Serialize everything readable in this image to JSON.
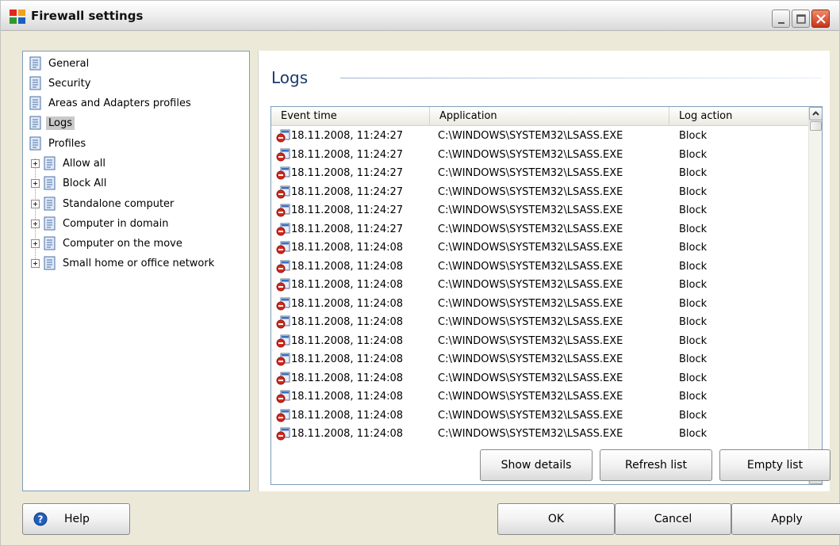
{
  "window": {
    "title": "Firewall settings"
  },
  "tree": {
    "items": [
      {
        "label": "General"
      },
      {
        "label": "Security"
      },
      {
        "label": "Areas and Adapters profiles"
      },
      {
        "label": "Logs",
        "selected": true
      },
      {
        "label": "Profiles"
      }
    ],
    "profiles": [
      {
        "label": "Allow all"
      },
      {
        "label": "Block All"
      },
      {
        "label": "Standalone computer"
      },
      {
        "label": "Computer in domain"
      },
      {
        "label": "Computer on the move"
      },
      {
        "label": "Small home or office network"
      }
    ]
  },
  "logs": {
    "title": "Logs",
    "columns": [
      "Event time",
      "Application",
      "Log action"
    ],
    "rows": [
      [
        "18.11.2008, 11:24:27",
        "C:\\WINDOWS\\SYSTEM32\\LSASS.EXE",
        "Block"
      ],
      [
        "18.11.2008, 11:24:27",
        "C:\\WINDOWS\\SYSTEM32\\LSASS.EXE",
        "Block"
      ],
      [
        "18.11.2008, 11:24:27",
        "C:\\WINDOWS\\SYSTEM32\\LSASS.EXE",
        "Block"
      ],
      [
        "18.11.2008, 11:24:27",
        "C:\\WINDOWS\\SYSTEM32\\LSASS.EXE",
        "Block"
      ],
      [
        "18.11.2008, 11:24:27",
        "C:\\WINDOWS\\SYSTEM32\\LSASS.EXE",
        "Block"
      ],
      [
        "18.11.2008, 11:24:27",
        "C:\\WINDOWS\\SYSTEM32\\LSASS.EXE",
        "Block"
      ],
      [
        "18.11.2008, 11:24:08",
        "C:\\WINDOWS\\SYSTEM32\\LSASS.EXE",
        "Block"
      ],
      [
        "18.11.2008, 11:24:08",
        "C:\\WINDOWS\\SYSTEM32\\LSASS.EXE",
        "Block"
      ],
      [
        "18.11.2008, 11:24:08",
        "C:\\WINDOWS\\SYSTEM32\\LSASS.EXE",
        "Block"
      ],
      [
        "18.11.2008, 11:24:08",
        "C:\\WINDOWS\\SYSTEM32\\LSASS.EXE",
        "Block"
      ],
      [
        "18.11.2008, 11:24:08",
        "C:\\WINDOWS\\SYSTEM32\\LSASS.EXE",
        "Block"
      ],
      [
        "18.11.2008, 11:24:08",
        "C:\\WINDOWS\\SYSTEM32\\LSASS.EXE",
        "Block"
      ],
      [
        "18.11.2008, 11:24:08",
        "C:\\WINDOWS\\SYSTEM32\\LSASS.EXE",
        "Block"
      ],
      [
        "18.11.2008, 11:24:08",
        "C:\\WINDOWS\\SYSTEM32\\LSASS.EXE",
        "Block"
      ],
      [
        "18.11.2008, 11:24:08",
        "C:\\WINDOWS\\SYSTEM32\\LSASS.EXE",
        "Block"
      ],
      [
        "18.11.2008, 11:24:08",
        "C:\\WINDOWS\\SYSTEM32\\LSASS.EXE",
        "Block"
      ],
      [
        "18.11.2008, 11:24:08",
        "C:\\WINDOWS\\SYSTEM32\\LSASS.EXE",
        "Block"
      ]
    ]
  },
  "buttons": {
    "show_details": "Show details",
    "refresh_list": "Refresh list",
    "empty_list": "Empty list",
    "help": "Help",
    "ok": "OK",
    "cancel": "Cancel",
    "apply": "Apply"
  },
  "colors": {
    "accent": "#1a3b6e",
    "window_bg": "#ece9d8",
    "border": "#7f9db9"
  },
  "icons": {
    "app": "avg-logo-icon",
    "tree": "document-icon",
    "row": "block-log-icon",
    "help": "help-icon"
  }
}
